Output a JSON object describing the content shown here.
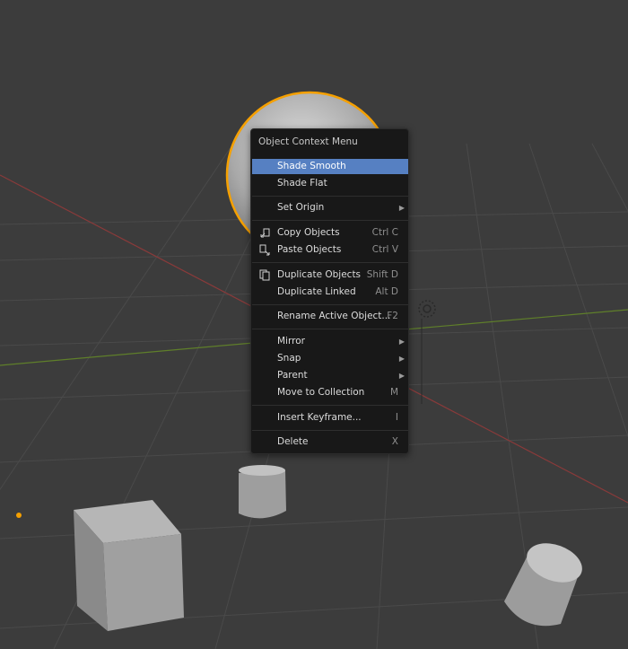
{
  "menu": {
    "title": "Object Context Menu",
    "items": [
      {
        "label": "Shade Smooth",
        "shortcut": "",
        "submenu": false,
        "active": true
      },
      {
        "label": "Shade Flat",
        "shortcut": "",
        "submenu": false
      },
      {
        "label": "Set Origin",
        "shortcut": "",
        "submenu": true
      },
      {
        "label": "Copy Objects",
        "shortcut": "Ctrl C",
        "submenu": false,
        "icon": "copy-icon"
      },
      {
        "label": "Paste Objects",
        "shortcut": "Ctrl V",
        "submenu": false,
        "icon": "paste-icon"
      },
      {
        "label": "Duplicate Objects",
        "shortcut": "Shift D",
        "submenu": false,
        "icon": "duplicate-icon"
      },
      {
        "label": "Duplicate Linked",
        "shortcut": "Alt D",
        "submenu": false
      },
      {
        "label": "Rename Active Object...",
        "shortcut": "F2",
        "submenu": false
      },
      {
        "label": "Mirror",
        "shortcut": "",
        "submenu": true
      },
      {
        "label": "Snap",
        "shortcut": "",
        "submenu": true
      },
      {
        "label": "Parent",
        "shortcut": "",
        "submenu": true
      },
      {
        "label": "Move to Collection",
        "shortcut": "M",
        "submenu": false
      },
      {
        "label": "Insert Keyframe...",
        "shortcut": "I",
        "submenu": false
      },
      {
        "label": "Delete",
        "shortcut": "X",
        "submenu": false
      }
    ]
  },
  "colors": {
    "background": "#3c3c3c",
    "grid": "#4a4a4a",
    "x_axis": "#8a3a3a",
    "y_axis": "#5f7f2a",
    "selection_outline": "#f5a000",
    "menu_background": "#181818",
    "menu_highlight": "#5680c2"
  }
}
